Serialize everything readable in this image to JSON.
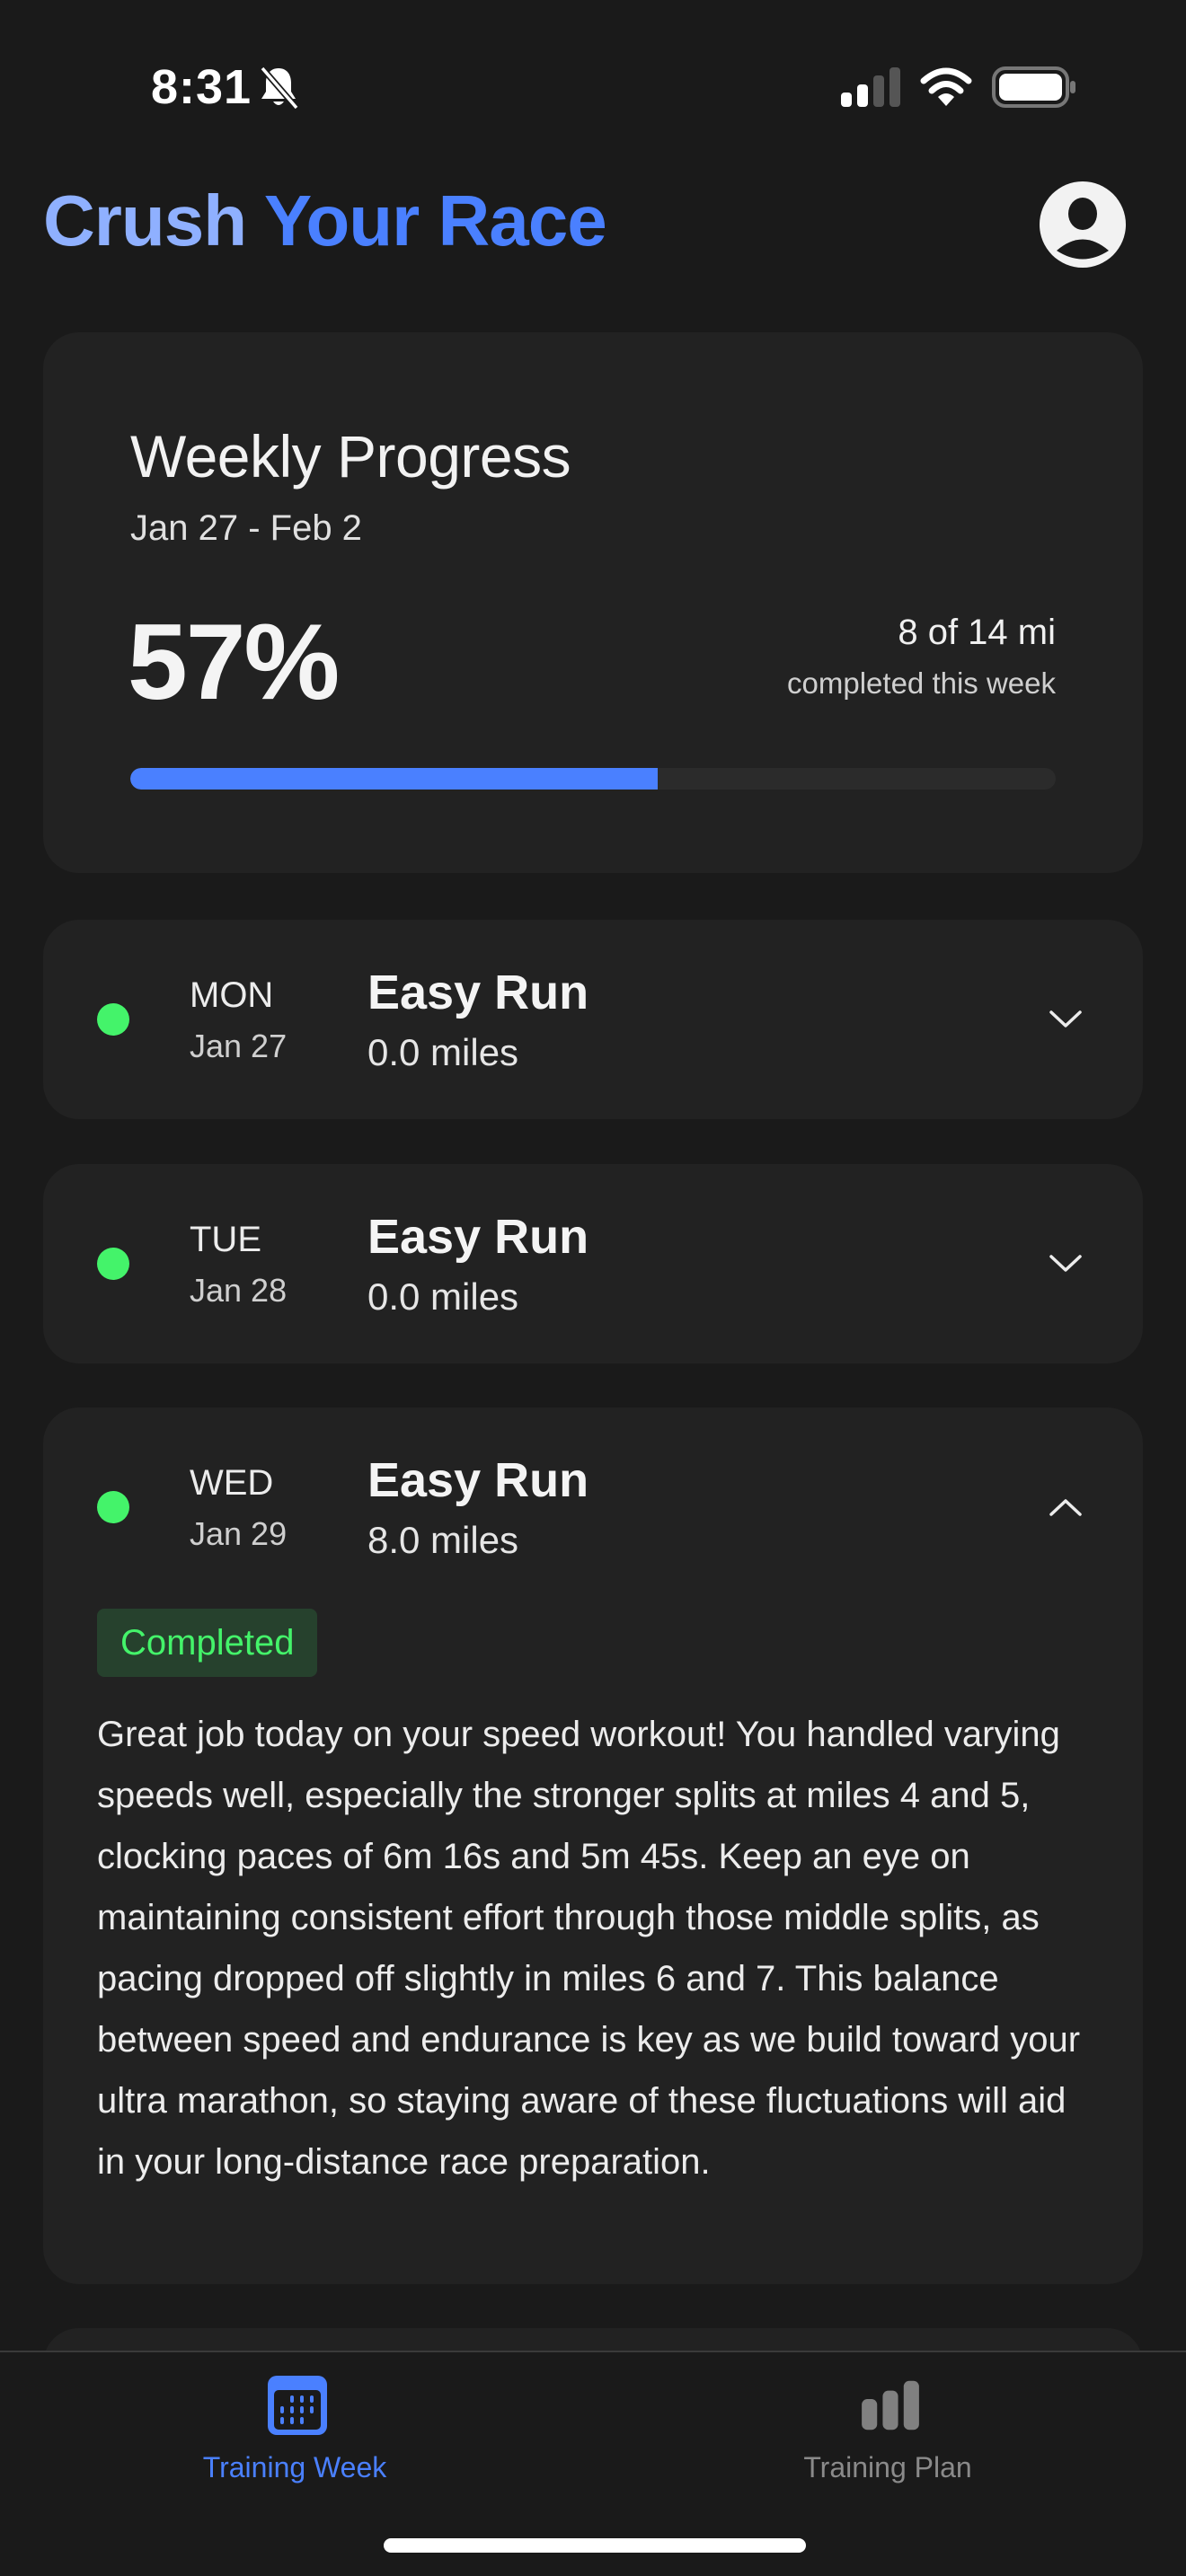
{
  "status_bar": {
    "time": "8:31",
    "icons": [
      "bell-slash-icon",
      "cellular-signal-icon",
      "wifi-icon",
      "battery-icon"
    ]
  },
  "header": {
    "title_part1": "Crush",
    "title_part2": "Your Race",
    "avatar_icon": "person-circle-icon"
  },
  "weekly_progress": {
    "title": "Weekly Progress",
    "date_range": "Jan 27 - Feb 2",
    "percent_label": "57%",
    "percent_value": 57,
    "miles_summary": "8 of 14 mi",
    "caption": "completed this week"
  },
  "days": [
    {
      "day": "MON",
      "date": "Jan 27",
      "workout": "Easy Run",
      "miles": "0.0 miles",
      "expanded": false,
      "chevron": "chevron-down-icon"
    },
    {
      "day": "TUE",
      "date": "Jan 28",
      "workout": "Easy Run",
      "miles": "0.0 miles",
      "expanded": false,
      "chevron": "chevron-down-icon"
    },
    {
      "day": "WED",
      "date": "Jan 29",
      "workout": "Easy Run",
      "miles": "8.0 miles",
      "expanded": true,
      "chevron": "chevron-up-icon",
      "status": "Completed",
      "feedback": "Great job today on your speed workout! You handled varying speeds well, especially the stronger splits at miles 4 and 5, clocking paces of 6m 16s and 5m 45s. Keep an eye on maintaining consistent effort through those middle splits, as pacing dropped off slightly in miles 6 and 7. This balance between speed and endurance is key as we build toward your ultra marathon, so staying aware of these fluctuations will aid in your long-distance race preparation."
    }
  ],
  "tab_bar": {
    "tabs": [
      {
        "label": "Training Week",
        "icon": "calendar-icon",
        "active": true
      },
      {
        "label": "Training Plan",
        "icon": "bar-chart-icon",
        "active": false
      }
    ]
  },
  "colors": {
    "accent": "#4a80ff",
    "accent_light": "#8fb0ff",
    "status_green": "#44f36a",
    "badge_bg": "#26412d",
    "background": "#1a1a1a",
    "card": "#222222",
    "inactive": "#8a8a8a"
  }
}
